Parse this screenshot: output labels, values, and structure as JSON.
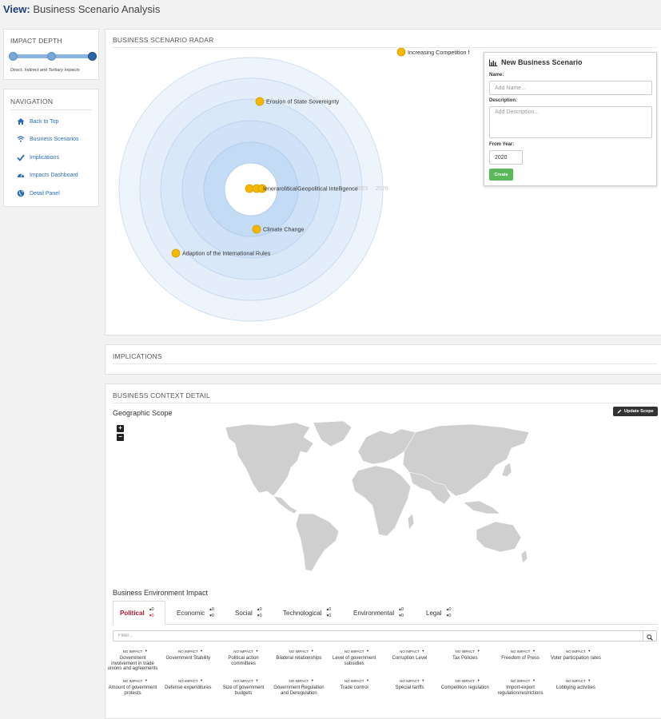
{
  "header": {
    "view_label": "View:",
    "title": "Business Scenario Analysis"
  },
  "impact_depth": {
    "heading": "IMPACT DEPTH",
    "caption": "Direct, Indirect and Tertiary Impacts",
    "levels": 3,
    "selected_level": 3
  },
  "navigation": {
    "heading": "NAVIGATION",
    "items": [
      {
        "label": "Back to Top",
        "icon": "home-icon"
      },
      {
        "label": "Business Scenarios",
        "icon": "wifi-icon"
      },
      {
        "label": "Implications",
        "icon": "check-icon"
      },
      {
        "label": "Impacts Dashboard",
        "icon": "dashboard-icon"
      },
      {
        "label": "Detail Panel",
        "icon": "globe-icon"
      }
    ]
  },
  "radar": {
    "heading": "BUSINESS SCENARIO RADAR",
    "year_labels": [
      "2025",
      "2026"
    ],
    "scenarios": [
      {
        "label": "Increasing Competition f"
      },
      {
        "label": "Erosion of State Sovereignty"
      },
      {
        "label": "Geopolitical Intelligence"
      },
      {
        "label": "Climate Change"
      },
      {
        "label": "Adaption of the International Rules"
      }
    ],
    "center_overlap_text": "Ienerarolitical"
  },
  "new_scenario": {
    "title": "New Business Scenario",
    "name_label": "Name:",
    "name_placeholder": "Add Name...",
    "description_label": "Description:",
    "description_placeholder": "Add Description...",
    "year_label": "From Year:",
    "year_value": "2020",
    "create_label": "Create"
  },
  "implications": {
    "heading": "IMPLICATIONS"
  },
  "context": {
    "heading": "BUSINESS CONTEXT DETAIL",
    "geo_title": "Geographic Scope",
    "update_label": "Update Scope",
    "zoom_in": "+",
    "zoom_out": "−",
    "bei_title": "Business Environment Impact",
    "tabs": [
      {
        "label": "Political",
        "up": "0",
        "down": "0"
      },
      {
        "label": "Economic",
        "up": "0",
        "down": "0"
      },
      {
        "label": "Social",
        "up": "0",
        "down": "0"
      },
      {
        "label": "Technological",
        "up": "0",
        "down": "0"
      },
      {
        "label": "Environmental",
        "up": "0",
        "down": "0"
      },
      {
        "label": "Legal",
        "up": "0",
        "down": "0"
      }
    ],
    "filter_placeholder": "Filter...",
    "impact_label": "NO IMPACT",
    "factors_row1": [
      "Government involvement in trade unions and agreements",
      "Government Stability",
      "Political action committees",
      "Bilateral relationships",
      "Level of government subsidies",
      "Corruption Level",
      "Tax Policies",
      "Freedom of Press",
      "Voter participation rates"
    ],
    "factors_row2": [
      "Amount of government protests",
      "Defense expenditures",
      "Size of government budgets",
      "Government Regulation and Deregulation",
      "Trade control",
      "Special tariffs",
      "Competition regulation",
      "Import-export regulation/restrictions",
      "Lobbying activities"
    ]
  },
  "colors": {
    "accent": "#2a6cb3",
    "title": "#1f3f77",
    "scenario_dot": "#f5b800",
    "create": "#5cb85c",
    "active_tab": "#b5172f"
  }
}
